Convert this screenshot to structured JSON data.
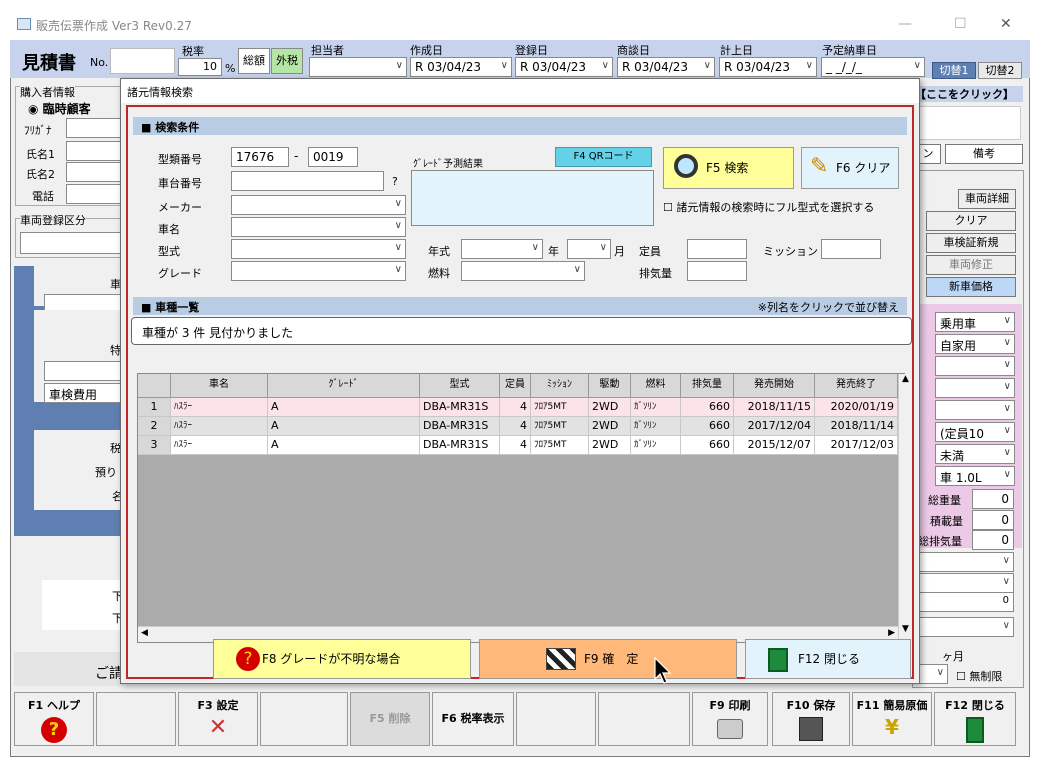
{
  "window": {
    "title": "販売伝票作成 Ver3 Rev0.27"
  },
  "header": {
    "doc_title": "見積書",
    "no_label": "No.",
    "tax_rate_label": "税率",
    "tax_rate_value": "10",
    "tax_pct": "%",
    "tax_total": "総額",
    "tax_ex": "外税",
    "staff_label": "担当者",
    "created_label": "作成日",
    "created_value": "R 03/04/23",
    "registered_label": "登録日",
    "registered_value": "R 03/04/23",
    "meeting_label": "商談日",
    "meeting_value": "R 03/04/23",
    "booked_label": "計上日",
    "booked_value": "R 03/04/23",
    "delivery_label": "予定納車日",
    "delivery_value": "_ _/_/_",
    "switch1": "切替1",
    "switch2": "切替2"
  },
  "bg_left": {
    "buyer_info": "購入者情報",
    "radio_temp": "臨時顧客",
    "furigana": "ﾌﾘｶﾞﾅ",
    "name1": "氏名1",
    "name2": "氏名2",
    "phone": "電話",
    "reg_class": "車両登録区分",
    "inspection_fee": "車検費用",
    "frag_car": "車",
    "frag_special": "特",
    "frag_tax": "税",
    "frag_deposit": "預り",
    "frag_name": "名",
    "frag_ge1": "下",
    "frag_ge2": "下",
    "frag_bottom": "ご請"
  },
  "bg_right": {
    "click_here": "【ここをクリック】",
    "tab_n": "ン",
    "tab_note": "備考",
    "vehicle_detail": "車両詳細",
    "clear": "クリア",
    "inspection_new": "車検証新規",
    "vehicle_fix": "車両修正",
    "new_price": "新車価格",
    "c1": "乗用車",
    "c2": "自家用",
    "c3": "(定員10",
    "c4": "未満",
    "c5": "車 1.0L",
    "gross_weight": "総重量",
    "gross_weight_v": "0",
    "load_weight": "積載量",
    "load_weight_v": "0",
    "total_disp": "総排気量",
    "total_disp_v": "0",
    "zero": "0",
    "months": "ヶ月",
    "unlimited": "無制限"
  },
  "dialog": {
    "title": "諸元情報検索",
    "search_section": "■ 検索条件",
    "type_no_label": "型類番号",
    "type_no_1": "17676",
    "dash": "-",
    "type_no_2": "0019",
    "chassis_label": "車台番号",
    "q_mark": "?",
    "maker_label": "メーカー",
    "car_name_label": "車名",
    "model_label": "型式",
    "grade_label": "グレード",
    "grade_pred_label": "ｸﾞﾚｰﾄﾞ予測結果",
    "qr_button": "F4 QRコード",
    "search_button": "F5 検索",
    "clear_button": "F6 クリア",
    "full_model_check": "諸元情報の検索時にフル型式を選択する",
    "year_label": "年式",
    "year_unit": "年",
    "month_unit": "月",
    "capacity_label": "定員",
    "mission_label": "ミッション",
    "fuel_label": "燃料",
    "displacement_label": "排気量",
    "list_section": "■ 車種一覧",
    "sort_hint": "※列名をクリックで並び替え",
    "result_msg": "車種が 3 件 見付かりました",
    "columns": [
      "車名",
      "ｸﾞﾚｰﾄﾞ",
      "型式",
      "定員",
      "ﾐｯｼｮﾝ",
      "駆動",
      "燃料",
      "排気量",
      "発売開始",
      "発売終了"
    ],
    "rows": [
      {
        "no": "1",
        "name": "ﾊｽﾗｰ",
        "grade": "A",
        "model": "DBA-MR31S",
        "cap": "4",
        "mission": "ﾌﾛｱ5MT",
        "drive": "2WD",
        "fuel": "ｶﾞｿﾘﾝ",
        "disp": "660",
        "start": "2018/11/15",
        "end": "2020/01/19"
      },
      {
        "no": "2",
        "name": "ﾊｽﾗｰ",
        "grade": "A",
        "model": "DBA-MR31S",
        "cap": "4",
        "mission": "ﾌﾛｱ5MT",
        "drive": "2WD",
        "fuel": "ｶﾞｿﾘﾝ",
        "disp": "660",
        "start": "2017/12/04",
        "end": "2018/11/14"
      },
      {
        "no": "3",
        "name": "ﾊｽﾗｰ",
        "grade": "A",
        "model": "DBA-MR31S",
        "cap": "4",
        "mission": "ﾌﾛｱ5MT",
        "drive": "2WD",
        "fuel": "ｶﾞｿﾘﾝ",
        "disp": "660",
        "start": "2015/12/07",
        "end": "2017/12/03"
      }
    ],
    "f8_button": "F8 グレードが不明な場合",
    "f9_button": "F9 確　定",
    "f12_button": "F12 閉じる"
  },
  "fkeys": {
    "f1": "F1 ヘルプ",
    "f3": "F3 設定",
    "f5": "F5 削除",
    "f6": "F6 税率表示",
    "f9": "F9 印刷",
    "f10": "F10 保存",
    "f11": "F11 簡易原価",
    "f12": "F12 閉じる"
  }
}
